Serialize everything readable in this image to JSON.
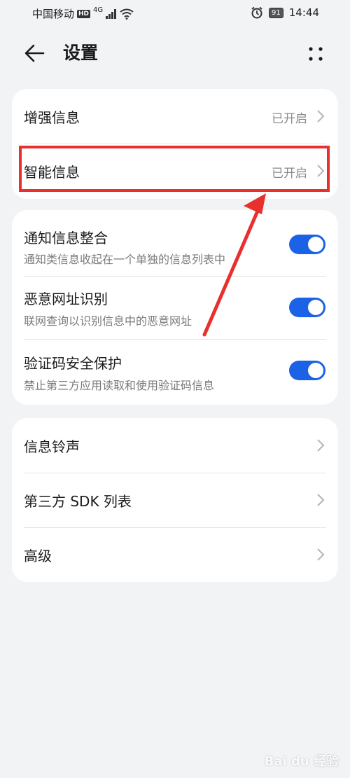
{
  "status_bar": {
    "carrier": "中国移动",
    "hd": "HD",
    "network": "4G",
    "battery": "91",
    "time": "14:44"
  },
  "header": {
    "title": "设置"
  },
  "card1": {
    "items": [
      {
        "label": "增强信息",
        "value": "已开启"
      },
      {
        "label": "智能信息",
        "value": "已开启"
      }
    ]
  },
  "card2": {
    "items": [
      {
        "label": "通知信息整合",
        "subtitle": "通知类信息收起在一个单独的信息列表中",
        "enabled": true
      },
      {
        "label": "恶意网址识别",
        "subtitle": "联网查询以识别信息中的恶意网址",
        "enabled": true
      },
      {
        "label": "验证码安全保护",
        "subtitle": "禁止第三方应用读取和使用验证码信息",
        "enabled": true
      }
    ]
  },
  "card3": {
    "items": [
      {
        "label": "信息铃声"
      },
      {
        "label": "第三方 SDK 列表"
      },
      {
        "label": "高级"
      }
    ]
  },
  "colors": {
    "accent": "#1c62e6",
    "annotation": "#e8312f"
  },
  "watermark": "Bai du 经验"
}
